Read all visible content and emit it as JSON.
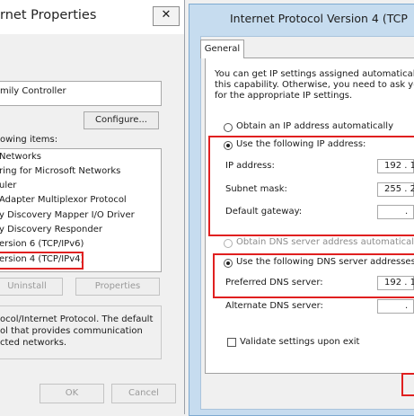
{
  "left_dialog": {
    "title": "rnet Properties",
    "close_glyph": "✕",
    "connect_fragment": "",
    "adapter_name": "mily Controller",
    "configure_label": "Configure...",
    "items_label": "owing items:",
    "items": [
      "Networks",
      "ring for Microsoft Networks",
      "uler",
      "Adapter Multiplexor Protocol",
      "y Discovery Mapper I/O Driver",
      "y Discovery Responder",
      "ersion 6 (TCP/IPv6)",
      "ersion 4 (TCP/IPv4)"
    ],
    "uninstall_label": "Uninstall",
    "properties_label": "Properties",
    "description": [
      "ocol/Internet Protocol. The default",
      "ol that provides communication",
      "cted networks."
    ],
    "ok_label": "OK",
    "cancel_label": "Cancel"
  },
  "right_dialog": {
    "title": "Internet Protocol Version 4 (TCP",
    "tab_general": "General",
    "intro_lines": [
      "You can get IP settings assigned automatically if",
      "this capability. Otherwise, you need to ask your",
      "for the appropriate IP settings."
    ],
    "radio_auto_ip": "Obtain an IP address automatically",
    "radio_manual_ip": "Use the following IP address:",
    "ip_address_label": "IP address:",
    "ip_address_value": "192 . 1",
    "subnet_mask_label": "Subnet mask:",
    "subnet_mask_value": "255 . 2",
    "default_gateway_label": "Default gateway:",
    "default_gateway_value": ".",
    "radio_auto_dns": "Obtain DNS server address automatically",
    "radio_manual_dns": "Use the following DNS server addresses:",
    "preferred_dns_label": "Preferred DNS server:",
    "preferred_dns_value": "192 . 1",
    "alternate_dns_label": "Alternate DNS server:",
    "alternate_dns_value": ".",
    "validate_label": "Validate settings upon exit"
  },
  "colors": {
    "highlight_red": "#e02020",
    "title_bar_blue": "#c6dcef"
  }
}
